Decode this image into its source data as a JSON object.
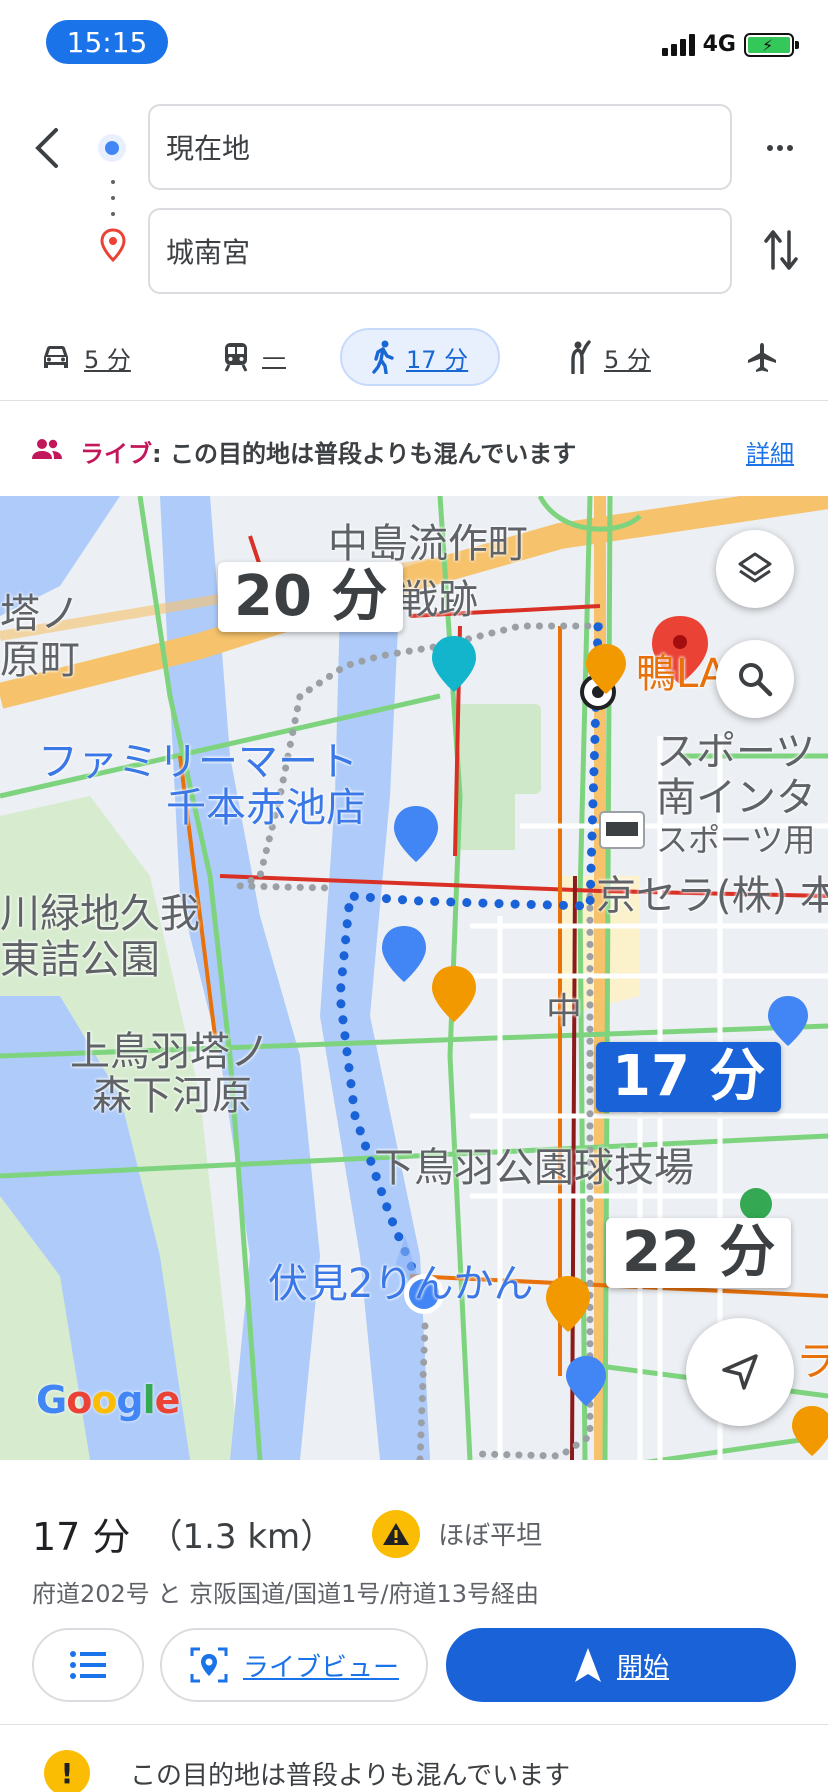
{
  "status": {
    "time": "15:15",
    "network": "4G"
  },
  "route": {
    "origin": "現在地",
    "destination": "城南宮"
  },
  "modes": [
    {
      "name": "car",
      "value": "5 分",
      "icon": "car-icon"
    },
    {
      "name": "transit",
      "value": "—",
      "icon": "train-icon"
    },
    {
      "name": "walk",
      "value": "17 分",
      "icon": "walk-icon",
      "active": true
    },
    {
      "name": "rideshare",
      "value": "5 分",
      "icon": "hail-icon"
    },
    {
      "name": "flight",
      "value": "",
      "icon": "airplane-icon"
    }
  ],
  "live": {
    "tag": "ライブ",
    "message": ": この目的地は普段よりも混んでいます",
    "link": "詳細"
  },
  "map": {
    "labels": {
      "nakajima": "中島流作町",
      "senseki": "戦跡",
      "tou_no": "塔ノ",
      "haramachi": "原町",
      "familymart_1": "ファミリーマート",
      "familymart_2": "千本赤池店",
      "sports_1": "スポーツ",
      "sports_2": "南インタ",
      "sports_3": "スポーツ用",
      "kyocera": "京セラ(株) 本",
      "ryokuchi_1": "川緑地久我",
      "ryokuchi_2": "東詰公園",
      "naka": "中",
      "kamitoba_1": "上鳥羽塔ノ",
      "kamitoba_2": "森下河原",
      "shimotoba": "下鳥羽公園球技場",
      "fushimi": "伏見2りんかん",
      "kamo": "鴨LA",
      "ra": "ラ"
    },
    "alt_time_1": "20 分",
    "main_time": "17 分",
    "alt_time_2": "22 分",
    "attribution": "Google"
  },
  "summary": {
    "time": "17 分",
    "distance": "（1.3 km）",
    "terrain": "ほぼ平坦",
    "via": "府道202号 と 京阪国道/国道1号/府道13号経由"
  },
  "actions": {
    "liveview": "ライブビュー",
    "start": "開始"
  },
  "notice": {
    "icon": "!",
    "text": "この目的地は普段よりも混んでいます"
  },
  "colors": {
    "accent": "#1a73e8",
    "live": "#c2185b",
    "warning": "#fbbc04",
    "destination": "#ea4335"
  }
}
